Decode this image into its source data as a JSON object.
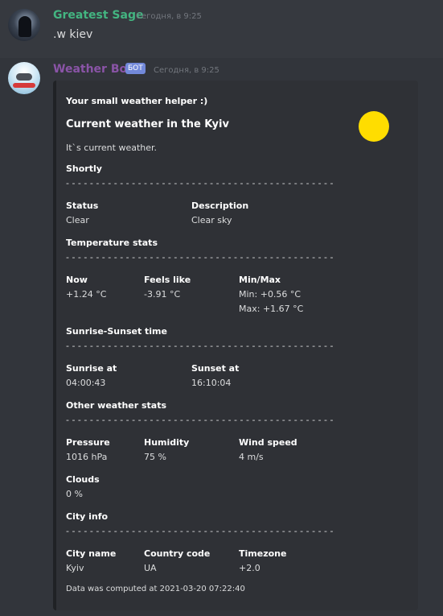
{
  "message1": {
    "author": "Greatest Sage",
    "timestamp": "Сегодня, в 9:25",
    "text": ".w kiev"
  },
  "message2": {
    "author": "Weather Bot",
    "bot_tag": "БОТ",
    "timestamp": "Сегодня, в 9:25"
  },
  "embed": {
    "author": "Your small weather helper :)",
    "title": "Current weather in the Kyiv",
    "description": "It`s current weather.",
    "separator": "- - - - - - - - - - - - - - - - - - - - - - - - - - - - - - - - - - - - - - - - - - - - -",
    "sections": {
      "shortly": "Shortly",
      "temperature": "Temperature stats",
      "sunrise": "Sunrise-Sunset time",
      "other": "Other weather stats",
      "city": "City info"
    },
    "fields": {
      "status": {
        "name": "Status",
        "value": "Clear"
      },
      "description": {
        "name": "Description",
        "value": "Clear sky"
      },
      "now": {
        "name": "Now",
        "value": "+1.24 °C"
      },
      "feels_like": {
        "name": "Feels like",
        "value": "-3.91 °C"
      },
      "minmax": {
        "name": "Min/Max",
        "min": "Min: +0.56 °C",
        "max": "Max: +1.67 °C"
      },
      "sunrise_at": {
        "name": "Sunrise at",
        "value": "04:00:43"
      },
      "sunset_at": {
        "name": "Sunset at",
        "value": "16:10:04"
      },
      "pressure": {
        "name": "Pressure",
        "value": "1016 hPa"
      },
      "humidity": {
        "name": "Humidity",
        "value": "75 %"
      },
      "wind": {
        "name": "Wind speed",
        "value": "4 m/s"
      },
      "clouds": {
        "name": "Clouds",
        "value": "0 %"
      },
      "city_name": {
        "name": "City name",
        "value": "Kyiv"
      },
      "country_code": {
        "name": "Country code",
        "value": "UA"
      },
      "timezone": {
        "name": "Timezone",
        "value": "+2.0"
      }
    },
    "footer": "Data was computed at 2021-03-20 07:22:40"
  }
}
